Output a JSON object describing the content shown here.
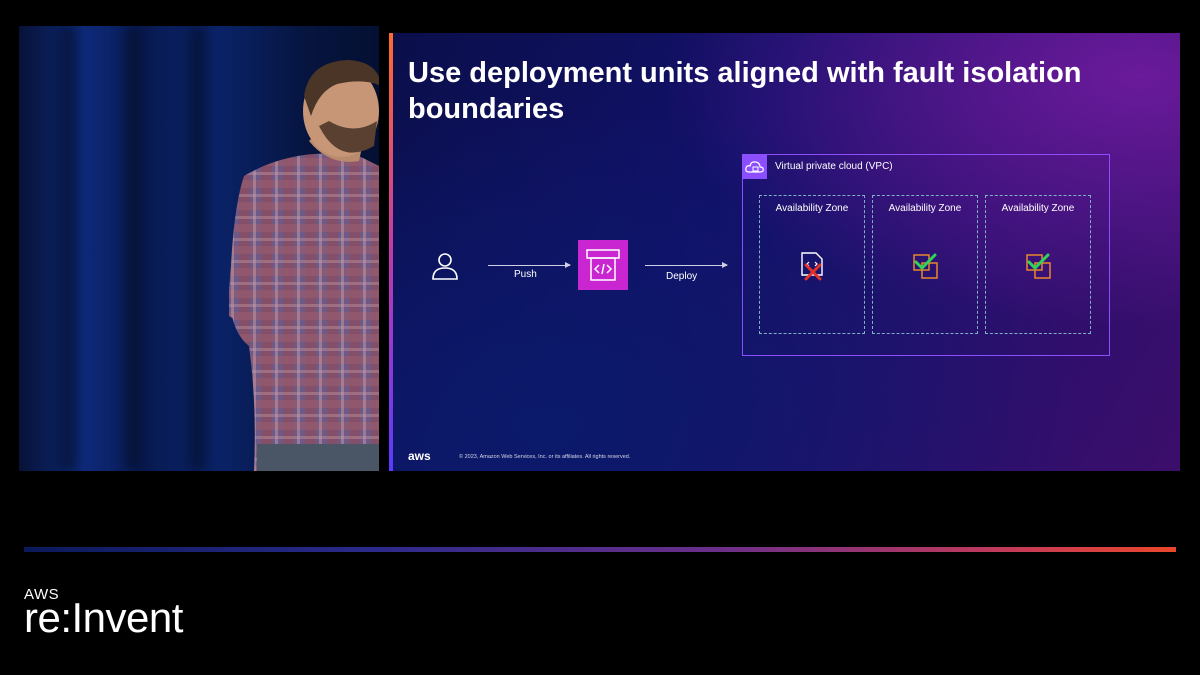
{
  "slide": {
    "title": "Use deployment units aligned with fault isolation boundaries",
    "push_label": "Push",
    "deploy_label": "Deploy",
    "vpc_label": "Virtual private cloud (VPC)",
    "availability_zones": [
      {
        "label": "Availability Zone",
        "status": "failed"
      },
      {
        "label": "Availability Zone",
        "status": "ok"
      },
      {
        "label": "Availability Zone",
        "status": "ok"
      }
    ],
    "aws_logo_text": "aws",
    "copyright": "© 2023, Amazon Web Services, Inc. or its affiliates. All rights reserved."
  },
  "event_brand": {
    "aws": "AWS",
    "name": "re:Invent"
  },
  "colors": {
    "pipeline": "#c925d1",
    "vpc_border": "#8c4fff",
    "az_border": "#7fb0c6",
    "ok_check": "#2fd25a",
    "fail_x": "#e0322b",
    "instance_orange": "#e7882b"
  }
}
